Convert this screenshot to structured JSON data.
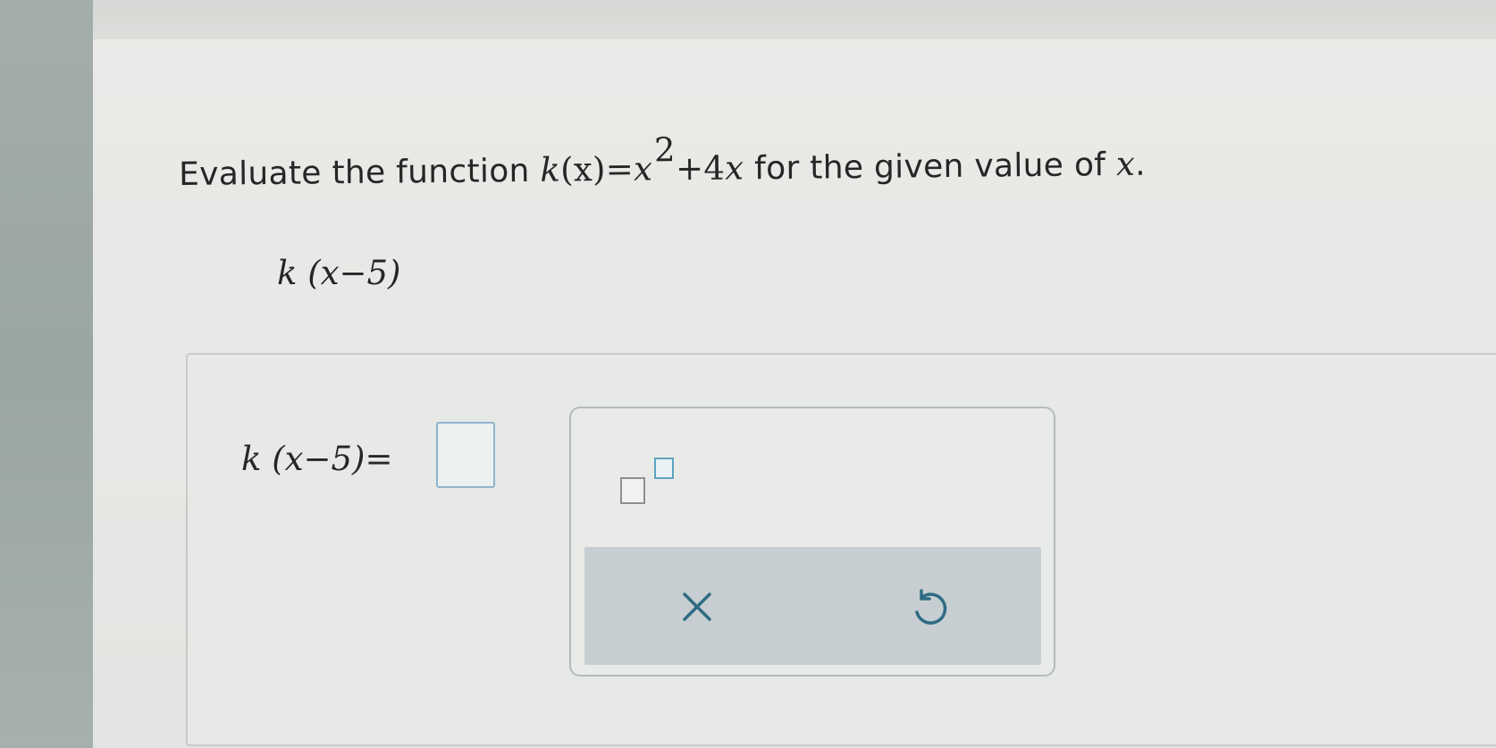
{
  "question": {
    "lead_text": "Evaluate the function",
    "func_name": "k",
    "func_arg": "(x)",
    "equals": "=",
    "base_var": "x",
    "exponent": "2",
    "plus_term": "+4",
    "term_var": "x",
    "trail_text": "for the given value of",
    "value_var": "x",
    "period": "."
  },
  "given_expression": {
    "func_name": "k",
    "arg": "(x−5)"
  },
  "answer": {
    "func_name": "k",
    "arg": "(x−5)",
    "equals": "=",
    "input_value": ""
  },
  "keypad": {
    "exponent_key": "superscript-template",
    "clear_icon": "close-icon",
    "undo_icon": "undo-icon",
    "accent_color": "#5fa3c1",
    "icon_color": "#2f6b84"
  }
}
